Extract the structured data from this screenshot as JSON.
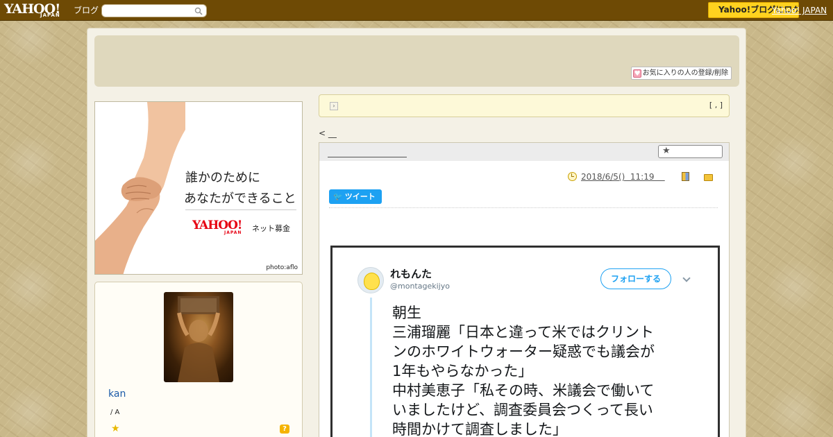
{
  "topbar": {
    "logo": "YAHOO!",
    "logo_sub": "JAPAN",
    "blog_label": "ブログ",
    "search_placeholder": "",
    "button_label": "Yahoo!ブログにログイン",
    "link_label": "Yahoo! JAPAN"
  },
  "header": {
    "favorite_button": "お気に入りの人の登録/削除"
  },
  "banner": {
    "line1": "誰かのために",
    "line2": "あなたができること",
    "logo": "YAHOO!",
    "logo_sub": "JAPAN",
    "bokin": "ネット募金",
    "credit": "photo:aflo"
  },
  "profile": {
    "name": "kan",
    "sub": "/ A",
    "help": "?"
  },
  "notice": {
    "arrow": "›",
    "bracket": "[ , ]"
  },
  "nav": {
    "prev": "< __"
  },
  "article": {
    "date": "2018/6/5()  11:19    ",
    "tweet_button": "ツイート"
  },
  "embed": {
    "name": "れもんた",
    "handle": "@montagekijyo",
    "follow": "フォローする",
    "lines": [
      "朝生",
      "三浦瑠麗「日本と違って米ではクリント",
      "ンのホワイトウォーター疑惑でも議会が",
      "1年もやらなかった」",
      "中村美恵子「私その時、米議会で働いて",
      "いましたけど、調査委員会つくって長い",
      "時間かけて調査しました」"
    ]
  },
  "colors": {
    "topbar": "#6e4a05",
    "yahoo_button": "#ffd21f",
    "twitter_blue": "#1da1f2",
    "link_blue": "#1a5aa8"
  }
}
